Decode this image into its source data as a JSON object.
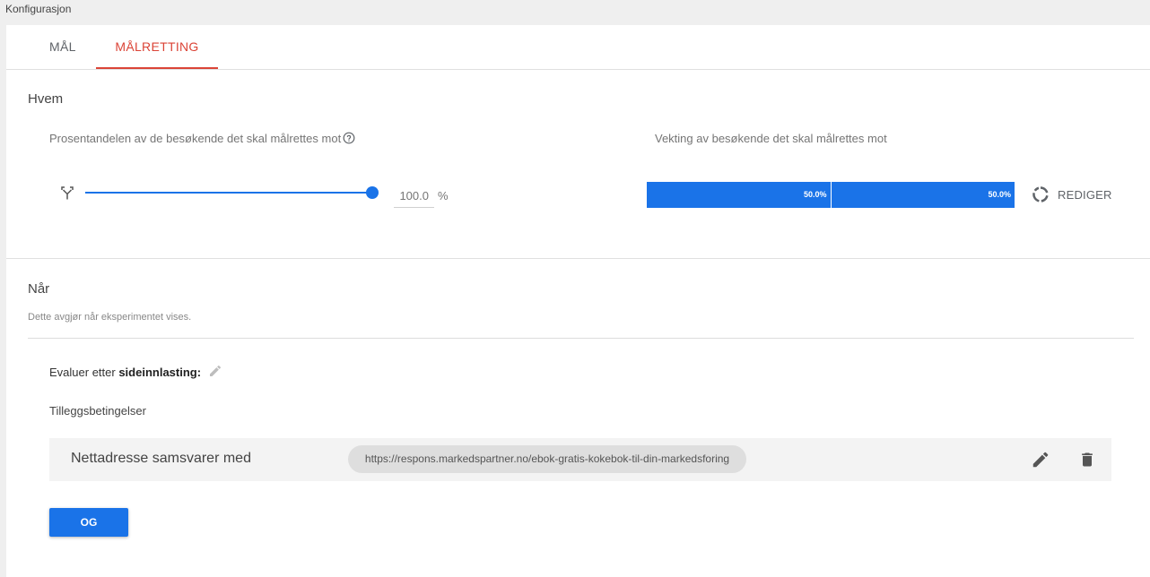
{
  "window": {
    "title": "Konfigurasjon"
  },
  "tabs": [
    {
      "label": "MÅL",
      "active": false
    },
    {
      "label": "MÅLRETTING",
      "active": true
    }
  ],
  "who": {
    "title": "Hvem",
    "percent_label": "Prosentandelen av de besøkende det skal målrettes mot",
    "slider_value": 1.0,
    "percent_value": "100.0",
    "percent_unit": "%",
    "weight_label": "Vekting av besøkende det skal målrettes mot",
    "weights": [
      "50.0%",
      "50.0%"
    ],
    "edit_label": "REDIGER"
  },
  "when": {
    "title": "Når",
    "description": "Dette avgjør når eksperimentet vises.",
    "evaluate_prefix": "Evaluer etter ",
    "evaluate_value": "sideinnlasting:",
    "extra_conditions_label": "Tilleggsbetingelser",
    "condition": {
      "label": "Nettadresse samsvarer med",
      "value": "https://respons.markedspartner.no/ebok-gratis-kokebok-til-din-markedsforing"
    },
    "and_button": "OG"
  },
  "colors": {
    "accent": "#1a73e8",
    "active_tab": "#db4437"
  },
  "icons": [
    "help-icon",
    "split-icon",
    "rediger-circle-icon",
    "pencil-icon",
    "trash-icon"
  ]
}
